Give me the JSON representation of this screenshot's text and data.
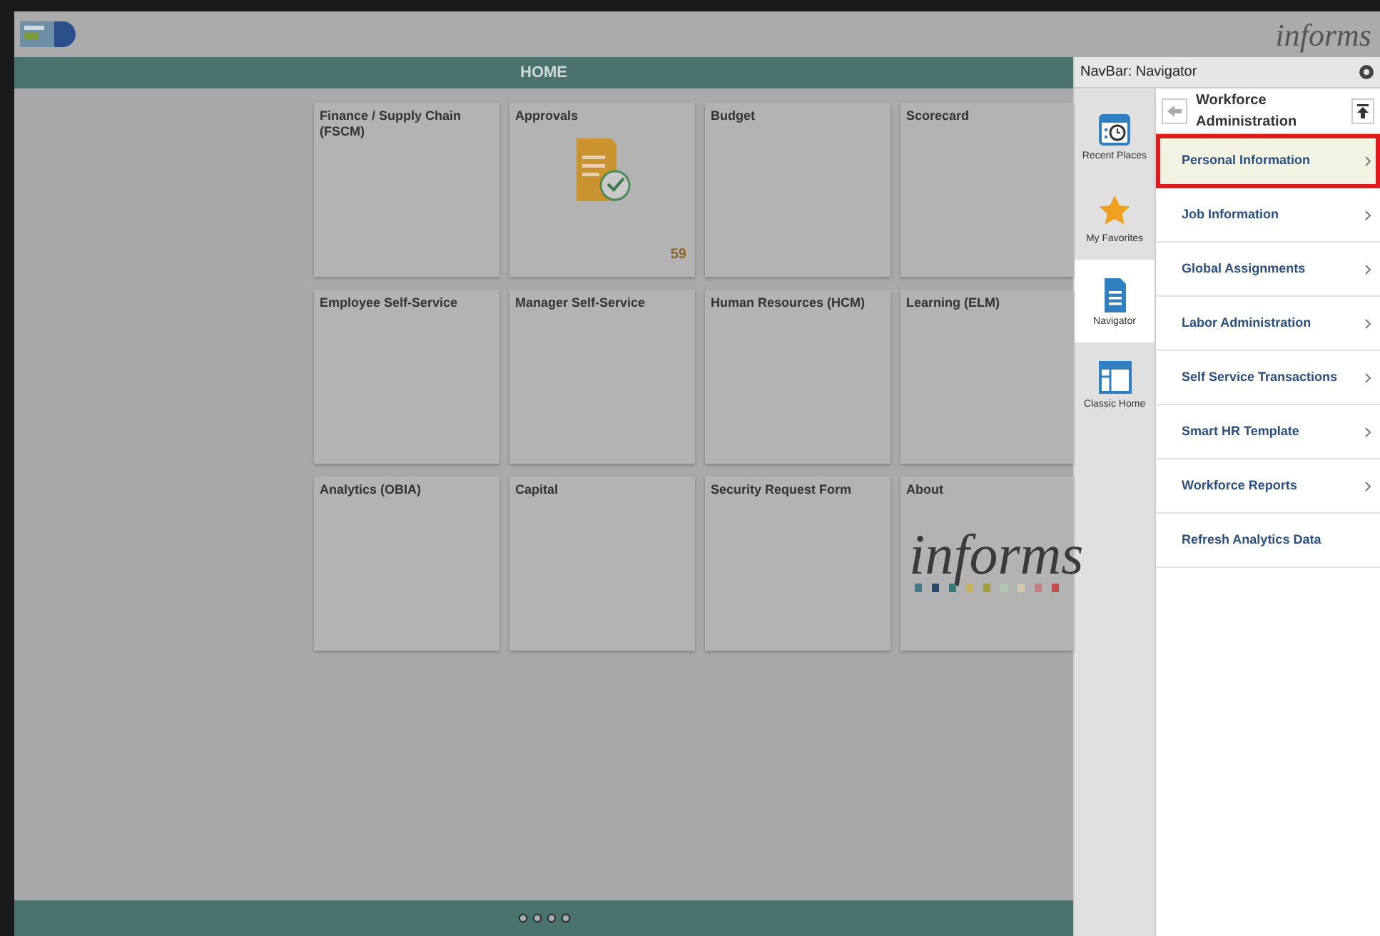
{
  "header": {
    "logo_text": "informs"
  },
  "home_bar": {
    "title": "HOME"
  },
  "tiles": [
    {
      "label": "Finance / Supply Chain (FSCM)",
      "kind": "plain"
    },
    {
      "label": "Approvals",
      "kind": "approvals",
      "count": "59"
    },
    {
      "label": "Budget",
      "kind": "plain"
    },
    {
      "label": "Scorecard",
      "kind": "plain"
    },
    {
      "label": "Employee Self-Service",
      "kind": "plain"
    },
    {
      "label": "Manager Self-Service",
      "kind": "plain"
    },
    {
      "label": "Human Resources (HCM)",
      "kind": "plain"
    },
    {
      "label": "Learning (ELM)",
      "kind": "plain"
    },
    {
      "label": "Analytics (OBIA)",
      "kind": "plain"
    },
    {
      "label": "Capital",
      "kind": "plain"
    },
    {
      "label": "Security Request Form",
      "kind": "plain"
    },
    {
      "label": "About",
      "kind": "logo",
      "logo_text": "informs"
    }
  ],
  "page_dots": [
    {
      "selected": false
    },
    {
      "selected": false
    },
    {
      "selected": false
    },
    {
      "selected": false
    }
  ],
  "navbar": {
    "title": "NavBar: Navigator",
    "rail": [
      {
        "label": "Recent Places",
        "kind": "recent",
        "selected": false
      },
      {
        "label": "My Favorites",
        "kind": "favorites",
        "selected": false
      },
      {
        "label": "Navigator",
        "kind": "navigator",
        "selected": true
      },
      {
        "label": "Classic Home",
        "kind": "classic",
        "selected": false
      }
    ],
    "folder_title": "Workforce Administration",
    "items": [
      {
        "label": "Personal Information",
        "kind": "folder",
        "selected": true
      },
      {
        "label": "Job Information",
        "kind": "folder",
        "selected": false
      },
      {
        "label": "Global Assignments",
        "kind": "folder",
        "selected": false
      },
      {
        "label": "Labor Administration",
        "kind": "folder",
        "selected": false
      },
      {
        "label": "Self Service Transactions",
        "kind": "folder",
        "selected": false
      },
      {
        "label": "Smart HR Template",
        "kind": "folder",
        "selected": false
      },
      {
        "label": "Workforce Reports",
        "kind": "folder",
        "selected": false
      },
      {
        "label": "Refresh Analytics Data",
        "kind": "link",
        "selected": false
      }
    ]
  }
}
